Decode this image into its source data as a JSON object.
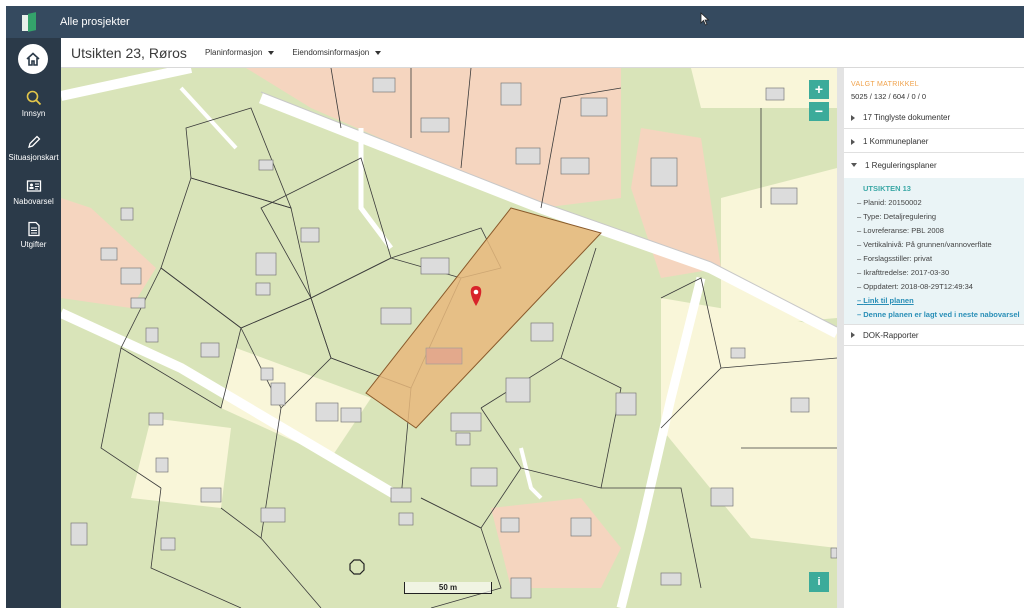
{
  "topbar": {
    "title": "Alle prosjekter"
  },
  "sidebar": {
    "items": [
      {
        "label": "Innsyn"
      },
      {
        "label": "Situasjonskart"
      },
      {
        "label": "Nabovarsel"
      },
      {
        "label": "Utgifter"
      }
    ]
  },
  "header": {
    "address": "Utsikten 23, Røros",
    "menus": [
      {
        "label": "Planinformasjon"
      },
      {
        "label": "Eiendomsinformasjon"
      }
    ]
  },
  "map": {
    "zoom_in": "+",
    "zoom_out": "−",
    "info": "i",
    "scale": "50 m",
    "colors": {
      "land": "#d9e4b9",
      "residential": "#f5d5bf",
      "cream": "#f9f6d9",
      "selected": "#e8b97c",
      "road": "#ffffff",
      "pin": "#d8232a"
    }
  },
  "panel": {
    "valgt_label": "VALGT MATRIKKEL",
    "valgt_value": "5025 / 132 / 604 / 0 / 0",
    "sections": [
      {
        "label": "17 Tinglyste dokumenter"
      },
      {
        "label": "1 Kommuneplaner"
      },
      {
        "label": "1 Reguleringsplaner"
      },
      {
        "label": "DOK-Rapporter"
      }
    ],
    "detail": {
      "title": "UTSIKTEN 13",
      "rows": [
        "Planid: 20150002",
        "Type: Detaljregulering",
        "Lovreferanse: PBL 2008",
        "Vertikalnivå: På grunnen/vannoverflate",
        "Forslagsstiller: privat",
        "Ikrafttredelse: 2017-03-30",
        "Oppdatert: 2018-08-29T12:49:34"
      ],
      "link": "Link til planen",
      "notice": "Denne planen er lagt ved i neste nabovarsel"
    }
  },
  "accent_color": "#3cab9a"
}
